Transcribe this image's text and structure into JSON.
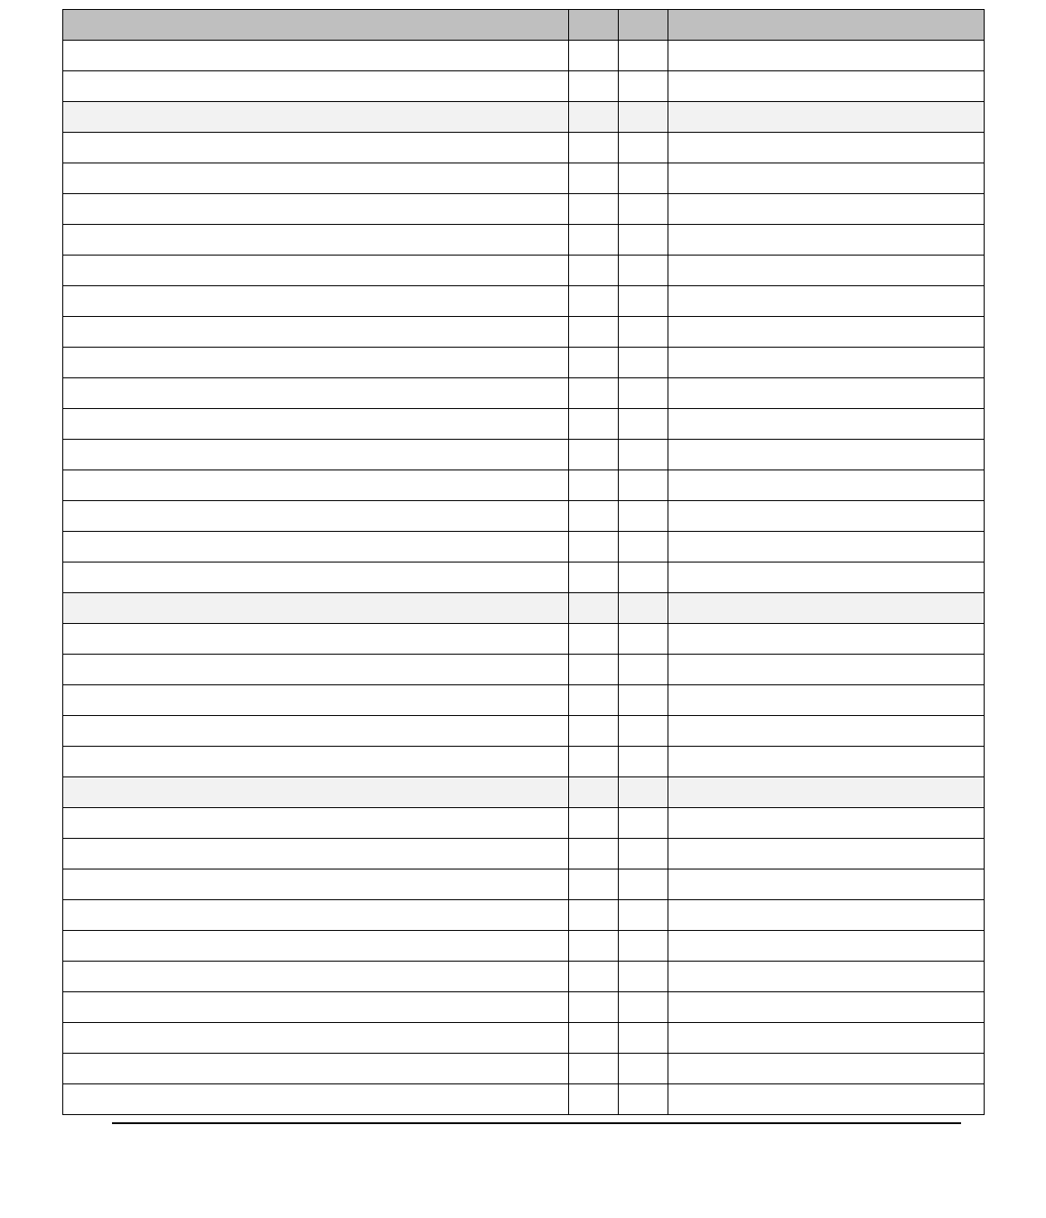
{
  "table": {
    "rows": [
      {
        "type": "header",
        "cells": [
          "",
          "",
          "",
          ""
        ]
      },
      {
        "type": "data",
        "cells": [
          "",
          "",
          "",
          ""
        ]
      },
      {
        "type": "data",
        "cells": [
          "",
          "",
          "",
          ""
        ]
      },
      {
        "type": "subheader",
        "cells": [
          "",
          "",
          "",
          ""
        ]
      },
      {
        "type": "data",
        "cells": [
          "",
          "",
          "",
          ""
        ]
      },
      {
        "type": "data",
        "cells": [
          "",
          "",
          "",
          ""
        ]
      },
      {
        "type": "data",
        "cells": [
          "",
          "",
          "",
          ""
        ]
      },
      {
        "type": "data",
        "cells": [
          "",
          "",
          "",
          ""
        ]
      },
      {
        "type": "data",
        "cells": [
          "",
          "",
          "",
          ""
        ]
      },
      {
        "type": "data",
        "cells": [
          "",
          "",
          "",
          ""
        ]
      },
      {
        "type": "data",
        "cells": [
          "",
          "",
          "",
          ""
        ]
      },
      {
        "type": "data",
        "cells": [
          "",
          "",
          "",
          ""
        ]
      },
      {
        "type": "data",
        "cells": [
          "",
          "",
          "",
          ""
        ]
      },
      {
        "type": "data",
        "cells": [
          "",
          "",
          "",
          ""
        ]
      },
      {
        "type": "data",
        "cells": [
          "",
          "",
          "",
          ""
        ]
      },
      {
        "type": "data",
        "cells": [
          "",
          "",
          "",
          ""
        ]
      },
      {
        "type": "data",
        "cells": [
          "",
          "",
          "",
          ""
        ]
      },
      {
        "type": "data",
        "cells": [
          "",
          "",
          "",
          ""
        ]
      },
      {
        "type": "data",
        "cells": [
          "",
          "",
          "",
          ""
        ]
      },
      {
        "type": "subheader",
        "cells": [
          "",
          "",
          "",
          ""
        ]
      },
      {
        "type": "data",
        "cells": [
          "",
          "",
          "",
          ""
        ]
      },
      {
        "type": "data",
        "cells": [
          "",
          "",
          "",
          ""
        ]
      },
      {
        "type": "data",
        "cells": [
          "",
          "",
          "",
          ""
        ]
      },
      {
        "type": "data",
        "cells": [
          "",
          "",
          "",
          ""
        ]
      },
      {
        "type": "data",
        "cells": [
          "",
          "",
          "",
          ""
        ]
      },
      {
        "type": "subheader",
        "cells": [
          "",
          "",
          "",
          ""
        ]
      },
      {
        "type": "data",
        "cells": [
          "",
          "",
          "",
          ""
        ]
      },
      {
        "type": "data",
        "cells": [
          "",
          "",
          "",
          ""
        ]
      },
      {
        "type": "data",
        "cells": [
          "",
          "",
          "",
          ""
        ]
      },
      {
        "type": "data",
        "cells": [
          "",
          "",
          "",
          ""
        ]
      },
      {
        "type": "data",
        "cells": [
          "",
          "",
          "",
          ""
        ]
      },
      {
        "type": "data",
        "cells": [
          "",
          "",
          "",
          ""
        ]
      },
      {
        "type": "data",
        "cells": [
          "",
          "",
          "",
          ""
        ]
      },
      {
        "type": "data",
        "cells": [
          "",
          "",
          "",
          ""
        ]
      },
      {
        "type": "data",
        "cells": [
          "",
          "",
          "",
          ""
        ]
      },
      {
        "type": "data",
        "cells": [
          "",
          "",
          "",
          ""
        ]
      }
    ]
  }
}
